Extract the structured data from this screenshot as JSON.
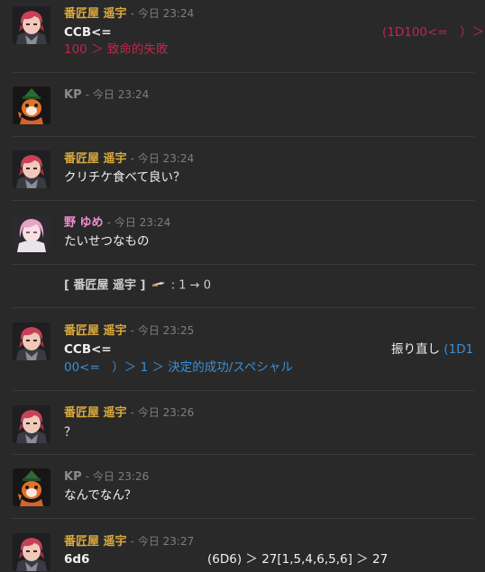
{
  "colors": {
    "background": "#292929",
    "name_bango": "#d9a93d",
    "name_kp": "#8c8c8c",
    "name_yume": "#ef8fd0",
    "fail": "#c3264c",
    "success": "#3a8fd8"
  },
  "messages": [
    {
      "speaker": "番匠屋 遥宇",
      "time": "- 今日 23:24",
      "avatar": "bango-avatar",
      "line1": "CCB<=",
      "line1_right": "(1D100<=　）＞",
      "line2": "100 ＞ 致命的失敗"
    },
    {
      "speaker": "KP",
      "time": "- 今日 23:24",
      "avatar": "kp-avatar"
    },
    {
      "speaker": "番匠屋 遥宇",
      "time": "- 今日 23:24",
      "avatar": "bango-avatar",
      "line1": "クリチケ食べて良い？"
    },
    {
      "speaker": "野 ゆめ",
      "time": "- 今日 23:24",
      "avatar": "yume-avatar",
      "line1": "たいせつなもの"
    },
    {
      "system": "[ 番匠屋 遥宇 ]",
      "system_value": ": 1 → 0"
    },
    {
      "speaker": "番匠屋 遥宇",
      "time": "- 今日 23:25",
      "avatar": "bango-avatar",
      "line1": "CCB<=",
      "line1_right_a": "振り直し",
      "line1_right_b": "(1D1",
      "line2": "00<=　）＞ 1 ＞ 決定的成功/スペシャル"
    },
    {
      "speaker": "番匠屋 遥宇",
      "time": "- 今日 23:26",
      "avatar": "bango-avatar",
      "line1": "？"
    },
    {
      "speaker": "KP",
      "time": "- 今日 23:26",
      "avatar": "kp-avatar",
      "line1": "なんでなん？"
    },
    {
      "speaker": "番匠屋 遥宇",
      "time": "- 今日 23:27",
      "avatar": "bango-avatar",
      "line1": "6d6",
      "line1_right": "(6D6) ＞ 27[1,5,4,6,5,6] ＞ 27"
    }
  ]
}
